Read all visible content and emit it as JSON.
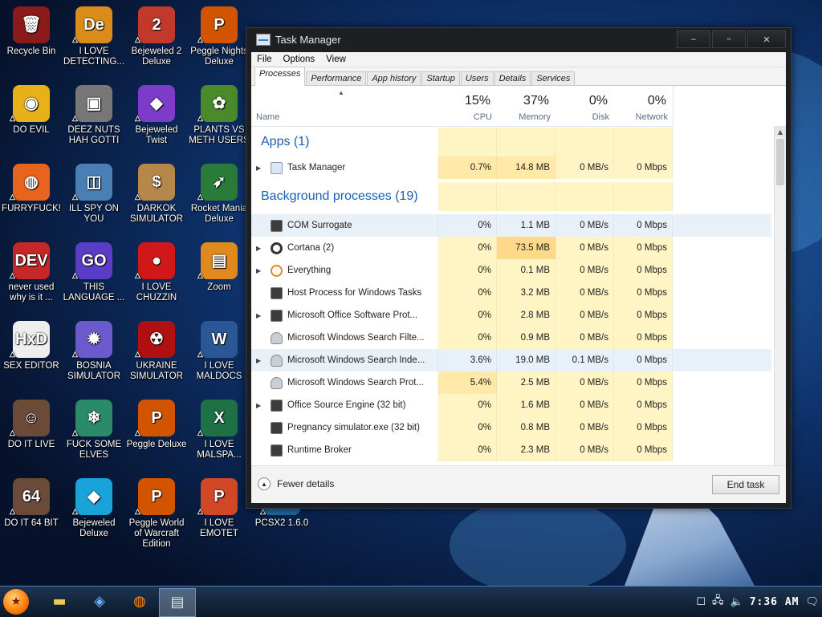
{
  "desktop_icons": [
    {
      "label": "Recycle Bin",
      "icon": "recycle-bin-icon",
      "color": "#8b1a1a",
      "glyph": "🗑"
    },
    {
      "label": "I LOVE DETECTING...",
      "icon": "detective-app-icon",
      "color": "#d98c1a",
      "glyph": "De"
    },
    {
      "label": "Bejeweled 2 Deluxe",
      "icon": "bejeweled-2-icon",
      "color": "#c0392b",
      "glyph": "2"
    },
    {
      "label": "Peggle Nights Deluxe",
      "icon": "peggle-nights-icon",
      "color": "#d35400",
      "glyph": "P"
    },
    {
      "label": "DO EVIL",
      "icon": "chrome-icon",
      "color": "#e8b019",
      "glyph": "◉"
    },
    {
      "label": "DEEZ NUTS HAH GOTTI",
      "icon": "stacked-windows-icon",
      "color": "#777",
      "glyph": "▣"
    },
    {
      "label": "Bejeweled Twist",
      "icon": "bejeweled-twist-icon",
      "color": "#7d3cc8",
      "glyph": "◆"
    },
    {
      "label": "PLANTS VS METH USERS",
      "icon": "plants-vs-zombies-icon",
      "color": "#4a8a2a",
      "glyph": "✿"
    },
    {
      "label": "FURRYFUCK!",
      "icon": "firefox-icon",
      "color": "#e8641c",
      "glyph": "◍"
    },
    {
      "label": "ILL SPY ON YOU",
      "icon": "spy-camera-icon",
      "color": "#4a7fb5",
      "glyph": "◫"
    },
    {
      "label": "DARKOK SIMULATOR",
      "icon": "money-bag-icon",
      "color": "#b5884a",
      "glyph": "$"
    },
    {
      "label": "Rocket Mania Deluxe",
      "icon": "rocket-mania-icon",
      "color": "#2a7a3a",
      "glyph": "➶"
    },
    {
      "label": "never used why is it ...",
      "icon": "dev-cpp-icon",
      "color": "#c62828",
      "glyph": "DEV"
    },
    {
      "label": "THIS LANGUAGE ...",
      "icon": "golang-icon",
      "color": "#5b3cc4",
      "glyph": "GO"
    },
    {
      "label": "I LOVE CHUZZIN",
      "icon": "chuzzle-icon",
      "color": "#d01818",
      "glyph": "●"
    },
    {
      "label": "Zoom",
      "icon": "zoom-icon",
      "color": "#e08a1e",
      "glyph": "▤"
    },
    {
      "label": "SEX EDITOR",
      "icon": "hxd-editor-icon",
      "color": "#eeeeee",
      "glyph": "HxD"
    },
    {
      "label": "BOSNIA SIMULATOR",
      "icon": "spiked-ball-icon",
      "color": "#6a5acd",
      "glyph": "✹"
    },
    {
      "label": "UKRAINE SIMULATOR",
      "icon": "radiation-icon",
      "color": "#b01010",
      "glyph": "☢"
    },
    {
      "label": "I LOVE MALDOCS",
      "icon": "word-icon",
      "color": "#2b5797",
      "glyph": "W"
    },
    {
      "label": "DO IT LIVE",
      "icon": "portrait-icon",
      "color": "#6b4a3a",
      "glyph": "☺"
    },
    {
      "label": "FUCK SOME ELVES",
      "icon": "santa-game-icon",
      "color": "#2a8a6a",
      "glyph": "❄"
    },
    {
      "label": "Peggle Deluxe",
      "icon": "peggle-deluxe-icon",
      "color": "#d35400",
      "glyph": "P"
    },
    {
      "label": "I LOVE MALSPA...",
      "icon": "excel-icon",
      "color": "#1e7145",
      "glyph": "X"
    },
    {
      "label": "DO IT 64 BIT",
      "icon": "portrait-64-icon",
      "color": "#6b4a3a",
      "glyph": "64"
    },
    {
      "label": "Bejeweled Deluxe",
      "icon": "diamond-icon",
      "color": "#1aa3d9",
      "glyph": "◆"
    },
    {
      "label": "Peggle World of Warcraft Edition",
      "icon": "peggle-wow-icon",
      "color": "#d35400",
      "glyph": "P"
    },
    {
      "label": "I LOVE EMOTET",
      "icon": "powerpoint-icon",
      "color": "#d24726",
      "glyph": "P"
    },
    {
      "label": "PCSX2 1.6.0",
      "icon": "pcsx2-icon",
      "color": "#1a6aa0",
      "glyph": "P"
    }
  ],
  "window": {
    "title": "Task Manager",
    "minimize": "–",
    "maximize": "▫",
    "close": "✕"
  },
  "menu": [
    "File",
    "Options",
    "View"
  ],
  "tabs": [
    "Processes",
    "Performance",
    "App history",
    "Startup",
    "Users",
    "Details",
    "Services"
  ],
  "columns": {
    "name_label": "Name",
    "cpu": {
      "pct": "15%",
      "label": "CPU"
    },
    "memory": {
      "pct": "37%",
      "label": "Memory"
    },
    "disk": {
      "pct": "0%",
      "label": "Disk"
    },
    "network": {
      "pct": "0%",
      "label": "Network"
    }
  },
  "groups": {
    "apps": "Apps (1)",
    "background": "Background processes (19)"
  },
  "apps": [
    {
      "name": "Task Manager",
      "icon": "task-manager-icon",
      "expand": true,
      "cpu": "0.7%",
      "mem": "14.8 MB",
      "disk": "0 MB/s",
      "net": "0 Mbps"
    }
  ],
  "background": [
    {
      "name": "COM Surrogate",
      "icon": "app-window-icon",
      "expand": false,
      "cpu": "0%",
      "mem": "1.1 MB",
      "disk": "0 MB/s",
      "net": "0 Mbps"
    },
    {
      "name": "Cortana (2)",
      "icon": "cortana-icon",
      "expand": true,
      "cpu": "0%",
      "mem": "73.5 MB",
      "disk": "0 MB/s",
      "net": "0 Mbps"
    },
    {
      "name": "Everything",
      "icon": "search-magnifier-icon",
      "expand": true,
      "cpu": "0%",
      "mem": "0.1 MB",
      "disk": "0 MB/s",
      "net": "0 Mbps"
    },
    {
      "name": "Host Process for Windows Tasks",
      "icon": "app-window-icon",
      "expand": false,
      "cpu": "0%",
      "mem": "3.2 MB",
      "disk": "0 MB/s",
      "net": "0 Mbps"
    },
    {
      "name": "Microsoft Office Software Prot...",
      "icon": "app-window-icon",
      "expand": true,
      "cpu": "0%",
      "mem": "2.8 MB",
      "disk": "0 MB/s",
      "net": "0 Mbps"
    },
    {
      "name": "Microsoft Windows Search Filte...",
      "icon": "search-user-icon",
      "expand": false,
      "cpu": "0%",
      "mem": "0.9 MB",
      "disk": "0 MB/s",
      "net": "0 Mbps"
    },
    {
      "name": "Microsoft Windows Search Inde...",
      "icon": "search-user-icon",
      "expand": true,
      "cpu": "3.6%",
      "mem": "19.0 MB",
      "disk": "0.1 MB/s",
      "net": "0 Mbps"
    },
    {
      "name": "Microsoft Windows Search Prot...",
      "icon": "search-user-icon",
      "expand": false,
      "cpu": "5.4%",
      "mem": "2.5 MB",
      "disk": "0 MB/s",
      "net": "0 Mbps"
    },
    {
      "name": "Office Source Engine (32 bit)",
      "icon": "app-window-icon",
      "expand": true,
      "cpu": "0%",
      "mem": "1.6 MB",
      "disk": "0 MB/s",
      "net": "0 Mbps"
    },
    {
      "name": "Pregnancy simulator.exe (32 bit)",
      "icon": "app-window-icon",
      "expand": false,
      "cpu": "0%",
      "mem": "0.8 MB",
      "disk": "0 MB/s",
      "net": "0 Mbps"
    },
    {
      "name": "Runtime Broker",
      "icon": "app-window-icon",
      "expand": false,
      "cpu": "0%",
      "mem": "2.3 MB",
      "disk": "0 MB/s",
      "net": "0 Mbps"
    }
  ],
  "footer": {
    "fewer_details": "Fewer details",
    "end_task": "End task"
  },
  "taskbar": {
    "clock": "7:36 AM",
    "pinned": [
      "file-explorer-icon",
      "network-app-icon",
      "firefox-icon",
      "task-manager-icon"
    ]
  },
  "colors": {
    "heat_light": "#fff4c4",
    "heat_mid": "#ffe9a8",
    "heat_strong": "#ffd98a",
    "group_title": "#1a5fb0"
  }
}
